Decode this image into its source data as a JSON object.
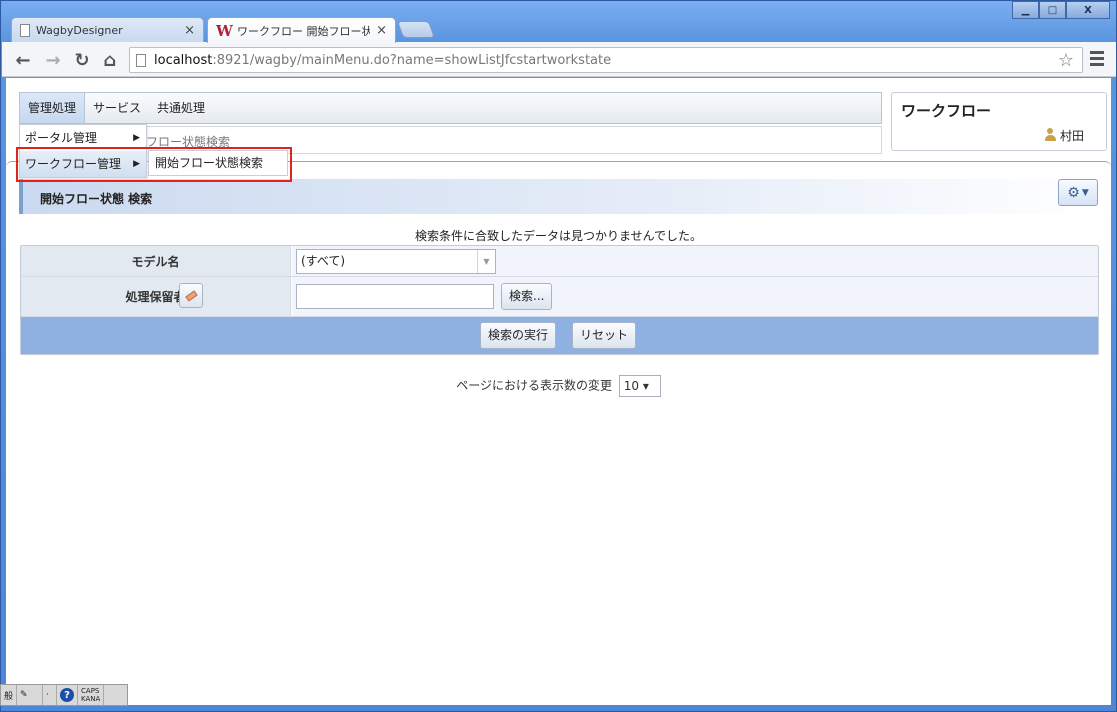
{
  "browser": {
    "tabs": [
      {
        "label": "WagbyDesigner",
        "close": "×"
      },
      {
        "label": "ワークフロー 開始フロー状態検",
        "close": "×",
        "icon": "W"
      }
    ],
    "url_host": "localhost",
    "url_rest": ":8921/wagby/mainMenu.do?name=showListJfcstartworkstate",
    "window_buttons": {
      "minimize": "▁",
      "maximize": "□",
      "close": "X"
    }
  },
  "app": {
    "menu": [
      "管理処理",
      "サービス",
      "共通処理"
    ],
    "breadcrumb": "フロー状態検索",
    "dropdown": [
      {
        "label": "ポータル管理",
        "arrow": "▶"
      },
      {
        "label": "ワークフロー管理",
        "arrow": "▶"
      }
    ],
    "submenu": "開始フロー状態検索",
    "info_title": "ワークフロー",
    "user_name": "村田"
  },
  "section": {
    "title": "開始フロー状態 検索"
  },
  "message": "検索条件に合致したデータは見つかりませんでした。",
  "form": {
    "model_label": "モデル名",
    "model_value": "(すべて)",
    "holder_label": "処理保留者",
    "search_lookup": "検索...",
    "execute": "検索の実行",
    "reset": "リセット"
  },
  "pager": {
    "label": "ページにおける表示数の変更",
    "value": "10 ▾"
  },
  "ime": {
    "mode": "般",
    "caps": "CAPS",
    "kana": "KANA"
  }
}
